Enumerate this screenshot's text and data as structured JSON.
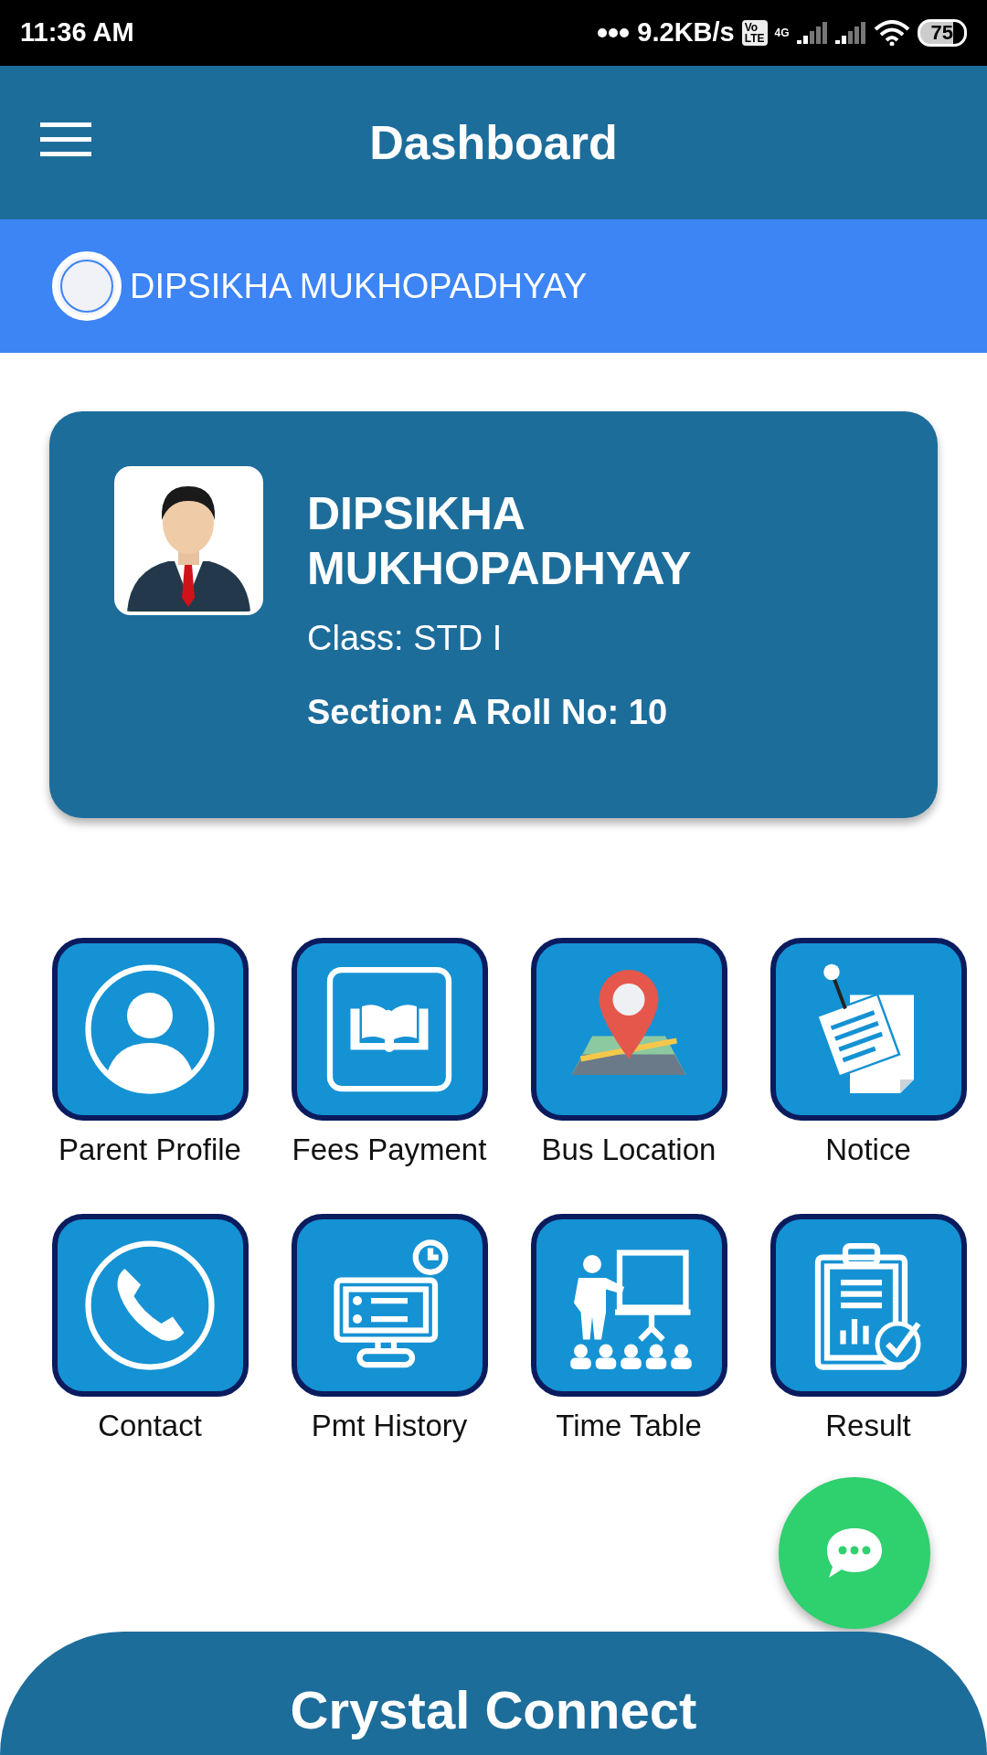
{
  "status_bar": {
    "time": "11:36 AM",
    "speed": "9.2KB/s",
    "volte_top": "Vo",
    "volte_bottom": "LTE",
    "network": "4G",
    "battery": "75"
  },
  "app_bar": {
    "title": "Dashboard"
  },
  "user_strip": {
    "name": "DIPSIKHA MUKHOPADHYAY"
  },
  "profile_card": {
    "name": "DIPSIKHA MUKHOPADHYAY",
    "class_line": "Class: STD I",
    "section_line": "Section: A Roll No: 10"
  },
  "menu": [
    {
      "label": "Parent Profile",
      "kind": "profile"
    },
    {
      "label": "Fees Payment",
      "kind": "book"
    },
    {
      "label": "Bus Location",
      "kind": "map"
    },
    {
      "label": "Notice",
      "kind": "notice"
    },
    {
      "label": "Contact",
      "kind": "phone"
    },
    {
      "label": "Pmt History",
      "kind": "monitor"
    },
    {
      "label": "Time Table",
      "kind": "teacher"
    },
    {
      "label": "Result",
      "kind": "report"
    }
  ],
  "footer": {
    "title": "Crystal Connect"
  }
}
